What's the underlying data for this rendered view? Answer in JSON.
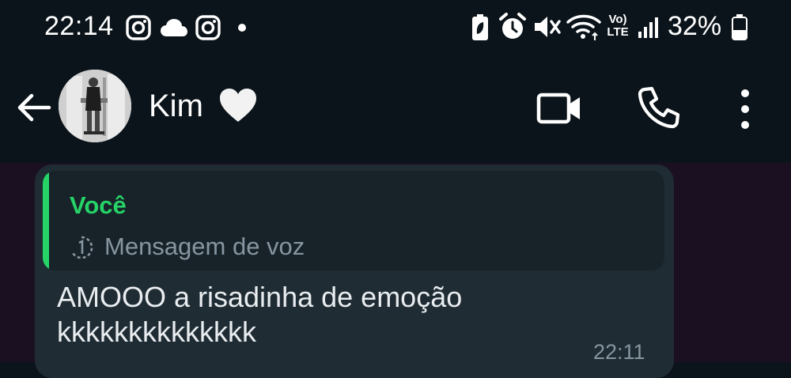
{
  "status_bar": {
    "time": "22:14",
    "battery_percent": "32%",
    "network_label_top": "Vo)",
    "network_label_bottom": "LTE",
    "icons_left": [
      "instagram-icon",
      "cloud-icon",
      "instagram-icon",
      "notification-dot-icon"
    ],
    "icons_right": [
      "battery-saver-icon",
      "alarm-icon",
      "mute-icon",
      "wifi-icon",
      "volte-icon",
      "signal-icon",
      "battery-icon"
    ]
  },
  "header": {
    "contact_name": "Kim",
    "contact_emoji": "white-heart-icon",
    "actions": [
      "video-call-icon",
      "voice-call-icon",
      "more-options-icon"
    ]
  },
  "message": {
    "quoted_author": "Você",
    "quoted_type": "Mensagem de voz",
    "text_line1": "AMOOO a risadinha de emoção",
    "text_line2": "kkkkkkkkkkkkkk",
    "time": "22:11"
  },
  "colors": {
    "background": "#0b141a",
    "chat_background": "#1b0f22",
    "bubble": "#1f2c34",
    "quote": "#182229",
    "accent": "#25d366",
    "muted": "#8696a0",
    "text": "#e9edef"
  }
}
